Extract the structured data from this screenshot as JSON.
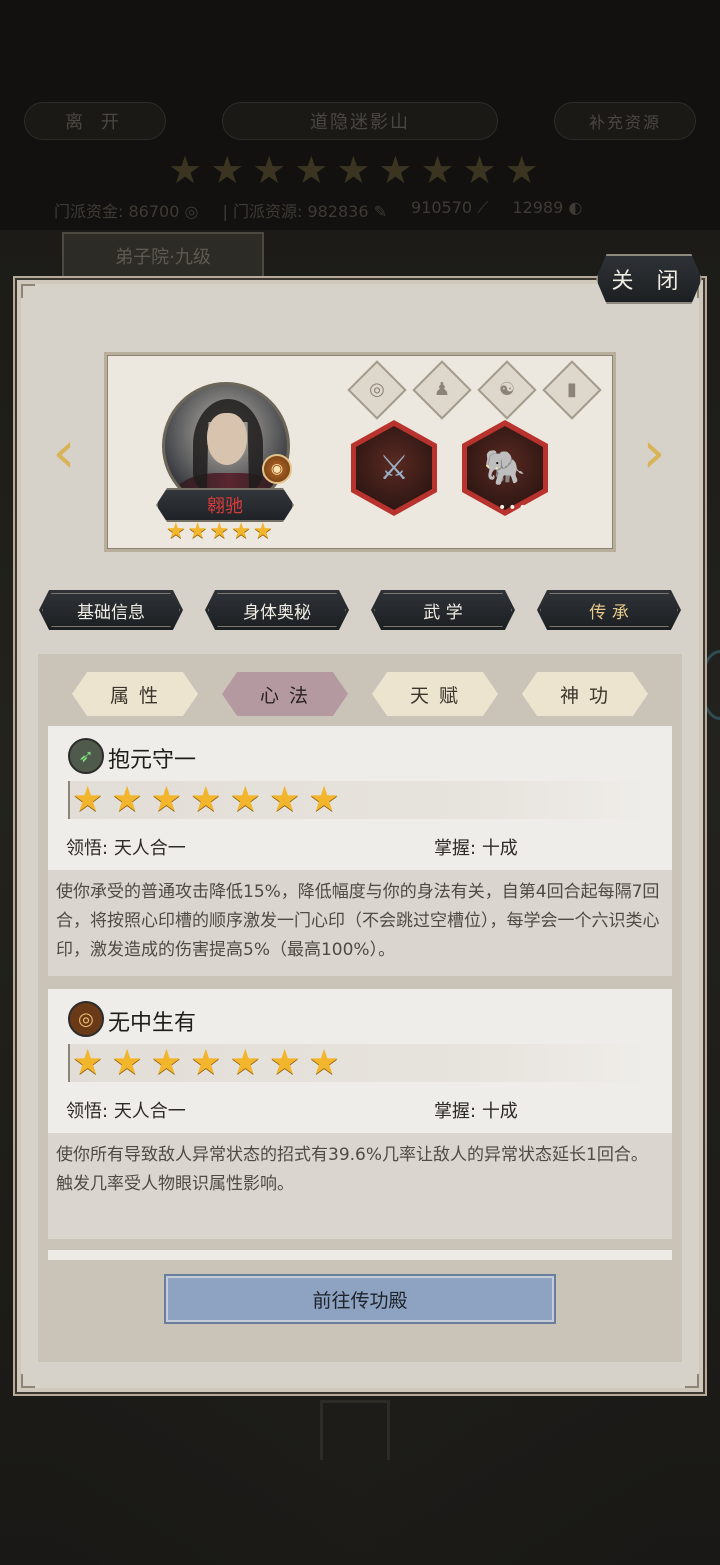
{
  "background": {
    "leave_label": "离 开",
    "location_title": "道隐迷影山",
    "refill_label": "补充资源",
    "sect_stars": [
      "★",
      "★",
      "★",
      "★",
      "★",
      "★",
      "★",
      "★",
      "★"
    ],
    "resources": {
      "funds_label": "门派资金:",
      "funds_value": "86700",
      "material_label": "门派资源:",
      "material_value": "982836",
      "value_3": "910570",
      "value_4": "12989"
    },
    "building_tab": "弟子院·九级"
  },
  "modal": {
    "close_label": "关 闭",
    "hero": {
      "name": "翱驰",
      "stars": [
        "★",
        "★",
        "★",
        "★",
        "★"
      ],
      "badge_icon": "coin-emblem",
      "slot_icons": [
        "swirl-icon",
        "person-icon",
        "yinyang-icon",
        "book-icon"
      ],
      "equipment": [
        {
          "icon": "mech-weapon-icon",
          "glyph": "⚔"
        },
        {
          "icon": "beast-mount-icon",
          "glyph": "🐘",
          "dots": "•••"
        }
      ]
    },
    "main_tabs": [
      "基础信息",
      "身体奥秘",
      "武 学",
      "传 承"
    ],
    "active_main_tab": 3,
    "sub_tabs": [
      "属性",
      "心法",
      "天赋",
      "神功"
    ],
    "active_sub_tab": 1,
    "skills": [
      {
        "name": "抱元守一",
        "icon": "leaf-icon",
        "stars": [
          "★",
          "★",
          "★",
          "★",
          "★",
          "★",
          "★"
        ],
        "comprehension_label": "领悟:",
        "comprehension_value": "天人合一",
        "mastery_label": "掌握:",
        "mastery_value": "十成",
        "description": "使你承受的普通攻击降低15%，降低幅度与你的身法有关，自第4回合起每隔7回合，将按照心印槽的顺序激发一门心印（不会跳过空槽位），每学会一个六识类心印，激发造成的伤害提高5%（最高100%）。"
      },
      {
        "name": "无中生有",
        "icon": "swirl-orb-icon",
        "stars": [
          "★",
          "★",
          "★",
          "★",
          "★",
          "★",
          "★"
        ],
        "comprehension_label": "领悟:",
        "comprehension_value": "天人合一",
        "mastery_label": "掌握:",
        "mastery_value": "十成",
        "description": "使你所有导致敌人异常状态的招式有39.6%几率让敌人的异常状态延长1回合。触发几率受人物眼识属性影响。"
      }
    ],
    "goto_label": "前往传功殿"
  },
  "colors": {
    "gold_star": "#f2b52b",
    "hex_frame": "#b9332e",
    "hero_name": "#d83b3b",
    "goto_button": "#8ea3c1"
  }
}
